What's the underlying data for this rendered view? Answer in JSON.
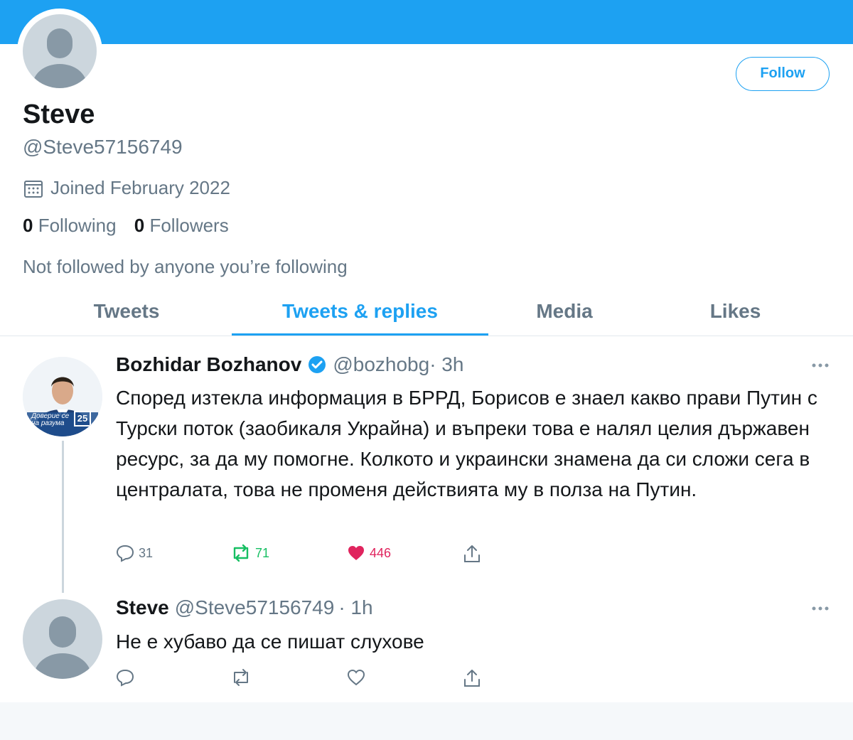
{
  "banner": {
    "color": "#1da1f2"
  },
  "profile": {
    "display_name": "Steve",
    "handle": "@Steve57156749",
    "follow_label": "Follow",
    "joined": "Joined February 2022",
    "following_count": "0",
    "following_label": "Following",
    "followers_count": "0",
    "followers_label": "Followers",
    "not_followed_text": "Not followed by anyone you’re following"
  },
  "tabs": [
    {
      "label": "Tweets",
      "active": false
    },
    {
      "label": "Tweets & replies",
      "active": true
    },
    {
      "label": "Media",
      "active": false
    },
    {
      "label": "Likes",
      "active": false
    }
  ],
  "tweets": [
    {
      "author": "Bozhidar Bozhanov",
      "verified": true,
      "handle": "@bozhobg",
      "time": "· 3h",
      "avatar_badge_text": "Доверие се на разума",
      "avatar_badge_number": "25",
      "text": "Според изтекла информация в БРРД, Борисов е знаел какво прави Путин с Турски поток (заобикаля Украйна) и въпреки това е налял целия държавен ресурс, за да му помогне. Колкото и украински знамена да си сложи сега в централата, това не променя действията му в полза на Путин.",
      "replies": "31",
      "retweets": "71",
      "likes": "446"
    },
    {
      "author": "Steve",
      "verified": false,
      "handle": "@Steve57156749",
      "time": "· 1h",
      "text": "Не е хубаво да се пишат слухове",
      "replies": "",
      "retweets": "",
      "likes": ""
    }
  ],
  "icons": {
    "calendar": "calendar-icon",
    "more": "more-icon",
    "reply": "reply-icon",
    "retweet": "retweet-icon",
    "like": "heart-icon",
    "share": "share-icon",
    "verified": "verified-badge-icon"
  },
  "colors": {
    "accent": "#1da1f2",
    "retweet": "#17bf63",
    "like": "#e0245e",
    "secondary_text": "#657786"
  }
}
